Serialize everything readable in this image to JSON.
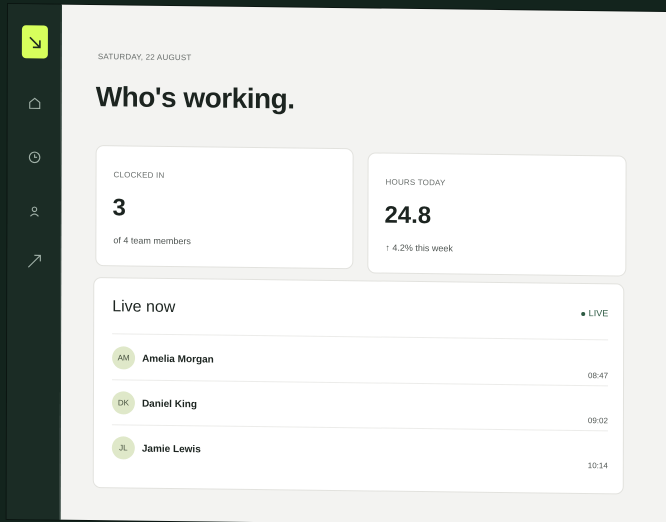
{
  "sidebar": {
    "logo_icon": "arrow-down-right-icon",
    "items": [
      {
        "icon": "home-icon"
      },
      {
        "icon": "clock-icon"
      },
      {
        "icon": "user-icon"
      },
      {
        "icon": "trend-up-icon"
      }
    ]
  },
  "header": {
    "date": "SATURDAY, 22 AUGUST",
    "title": "Who's working."
  },
  "stats": [
    {
      "label": "CLOCKED IN",
      "value": "3",
      "sub": "of 4 team members"
    },
    {
      "label": "HOURS TODAY",
      "value": "24.8",
      "sub": "↑ 4.2% this week"
    }
  ],
  "live": {
    "title": "Live now",
    "badge": "LIVE",
    "rows": [
      {
        "initials": "AM",
        "name": "Amelia Morgan",
        "time": "08:47"
      },
      {
        "initials": "DK",
        "name": "Daniel King",
        "time": "09:02"
      },
      {
        "initials": "JL",
        "name": "Jamie Lewis",
        "time": "10:14"
      }
    ]
  },
  "colors": {
    "accent": "#d7ff5c",
    "sidebar": "#1b2c25",
    "background": "#f3f3f1",
    "live_green": "#2d5a43",
    "avatar_bg": "#dfe8c9"
  }
}
